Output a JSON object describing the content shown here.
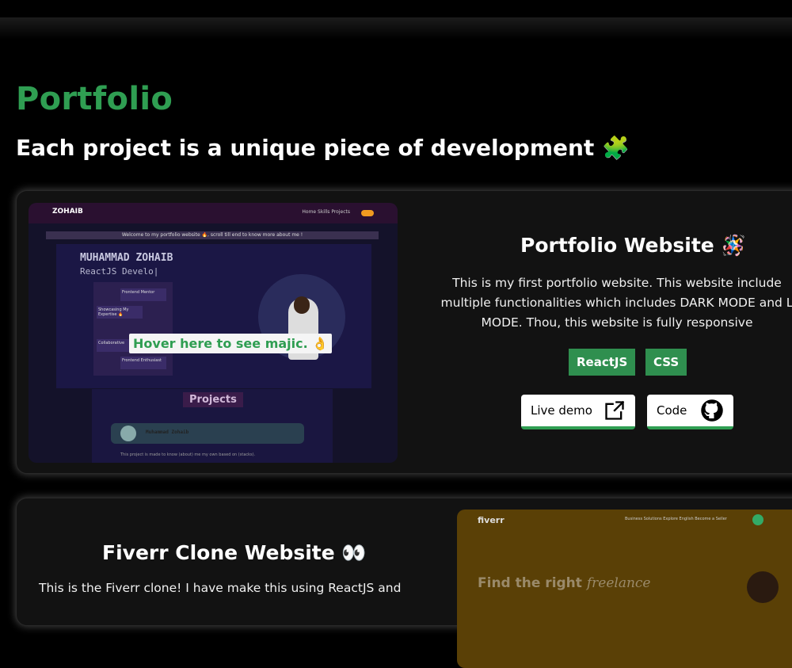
{
  "section": {
    "title": "Portfolio",
    "subtitle": "Each project is a unique piece of development 🧩"
  },
  "project1": {
    "title": "Portfolio Website 🪅",
    "description_lines": [
      "This is my first portfolio website. This website include",
      "multiple functionalities which includes DARK MODE and L",
      "MODE. Thou, this website is fully responsive"
    ],
    "tags": [
      "ReactJS",
      "CSS"
    ],
    "live_label": "Live demo",
    "code_label": "Code",
    "hover_tip": "Hover here to see majic. 👌",
    "preview": {
      "logo": "ZOHAIB",
      "nav_right": "Home   Skills   Projects",
      "banner": "Welcome to my portfolio website 🔥, scroll till end to know more about me !",
      "name": "MUHAMMAD ZOHAIB",
      "role": "ReactJS Develo|",
      "pills": [
        "Frontend Mentor",
        "Showcasing My Expertise 🔥",
        "Collaborative",
        "Frontend Enthusiast"
      ],
      "projects_label": "Projects",
      "user_name": "Muhammad Zohaib",
      "desc": "This project is made to know (about) me my own based on (stacks)."
    },
    "icons": {
      "live": "external-link-icon",
      "code": "github-icon"
    }
  },
  "project2": {
    "title": "Fiverr Clone Website 👀",
    "description_line": "This is the Fiverr clone! I have make this using ReactJS and",
    "preview": {
      "logo": "fiverr",
      "nav": "Business Solutions    Explore    English    Become a Seller",
      "headline_start": "Find the right ",
      "headline_em": "freelance"
    }
  },
  "colors": {
    "accent": "#2f9e52",
    "tag_bg": "#2f8f4f",
    "background": "#000000",
    "card_bg": "#121212"
  }
}
